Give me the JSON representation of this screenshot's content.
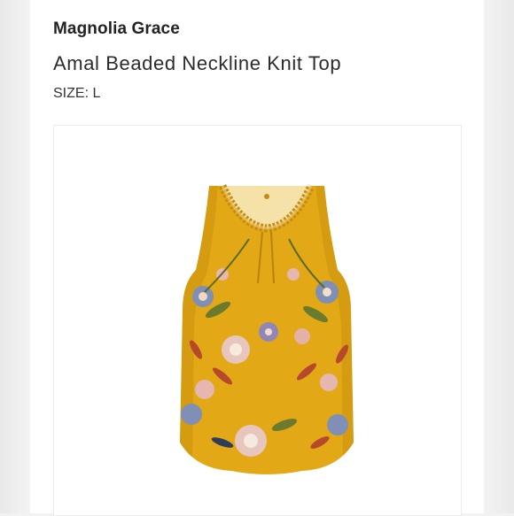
{
  "product": {
    "brand": "Magnolia Grace",
    "name": "Amal Beaded Neckline Knit Top",
    "size_label": "SIZE:",
    "size_value": "L"
  },
  "image": {
    "subject_icon": "product-photo",
    "colors": {
      "fabric": "#e3aa17",
      "fabric_shade": "#c88f0e",
      "flower_blue": "#7f8fb5",
      "flower_pink": "#e4b8b4",
      "leaf_green": "#6c7a2e",
      "leaf_red": "#b6482b"
    }
  }
}
